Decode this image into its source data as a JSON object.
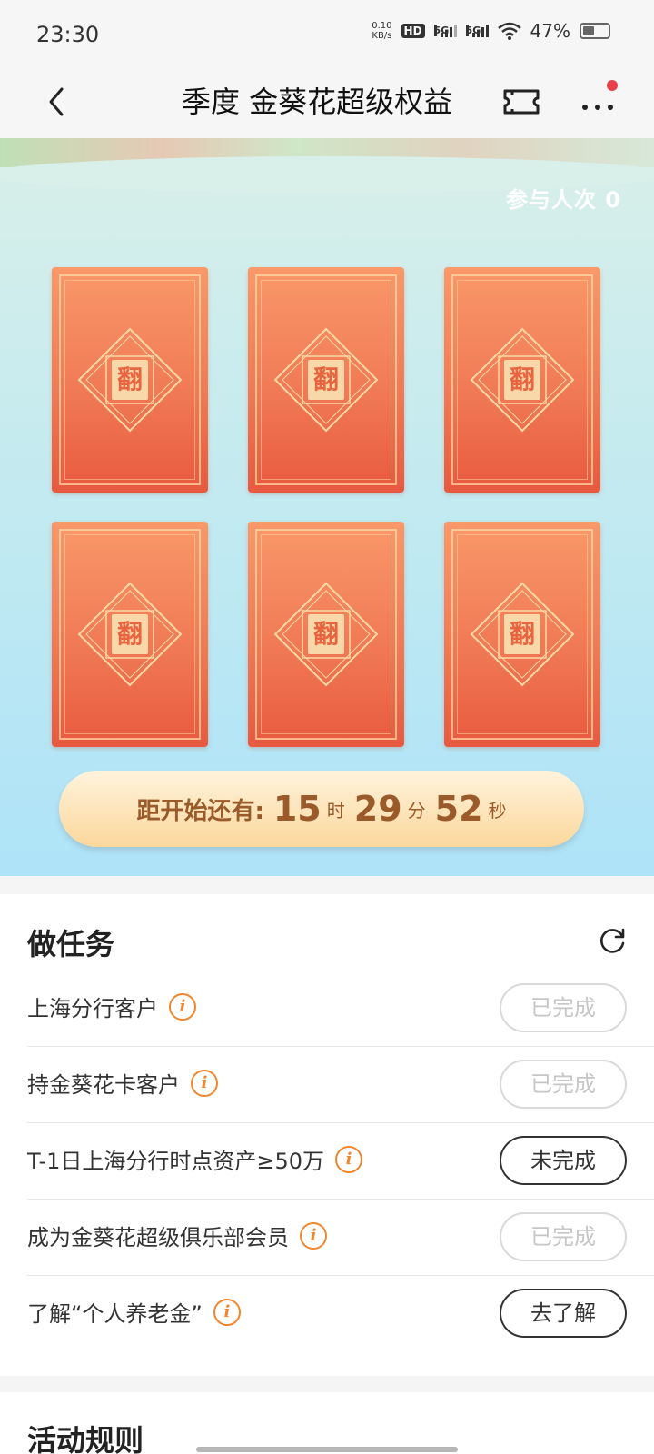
{
  "status_bar": {
    "time": "23:30",
    "net_speed_value": "0.10",
    "net_speed_unit": "KB/s",
    "hd": "HD",
    "signal1": "5G",
    "signal2": "5G",
    "battery": "47%"
  },
  "nav": {
    "title": "季度 金葵花超级权益",
    "back_icon": "chevron-left-icon",
    "ticket_icon": "ticket-icon",
    "more_icon": "more-icon"
  },
  "game": {
    "participants": "参与人次 0",
    "cards": [
      {
        "label": "翻"
      },
      {
        "label": "翻"
      },
      {
        "label": "翻"
      },
      {
        "label": "翻"
      },
      {
        "label": "翻"
      },
      {
        "label": "翻"
      }
    ],
    "countdown": {
      "label": "距开始还有:",
      "hours": "15",
      "hours_unit": "时",
      "minutes": "29",
      "minutes_unit": "分",
      "seconds": "52",
      "seconds_unit": "秒"
    }
  },
  "tasks": {
    "title": "做任务",
    "items": [
      {
        "label": "上海分行客户",
        "button": "已完成",
        "status": "done"
      },
      {
        "label": "持金葵花卡客户",
        "button": "已完成",
        "status": "done"
      },
      {
        "label": "T-1日上海分行时点资产≥50万",
        "button": "未完成",
        "status": "todo"
      },
      {
        "label": "成为金葵花超级俱乐部会员",
        "button": "已完成",
        "status": "done"
      },
      {
        "label": "了解“个人养老金”",
        "button": "去了解",
        "status": "todo"
      }
    ]
  },
  "rules": {
    "title": "活动规则"
  },
  "colors": {
    "accent_orange": "#f0862f",
    "card_top": "#f99869",
    "card_bottom": "#e8593f",
    "countdown_text": "#9a5a2a"
  }
}
